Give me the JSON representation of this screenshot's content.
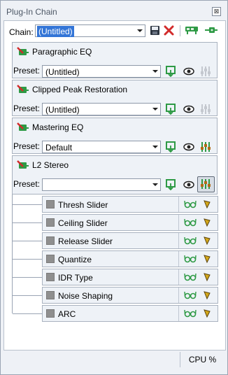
{
  "window": {
    "title": "Plug-In Chain",
    "close_glyph": "⊠"
  },
  "chain": {
    "label": "Chain:",
    "value": "(Untitled)"
  },
  "toolbar_icons": [
    "save-icon",
    "delete-icon",
    "insert-plugin-icon",
    "add-plugin-icon"
  ],
  "plugins": [
    {
      "name": "Paragraphic EQ",
      "preset_label": "Preset:",
      "preset": "(Untitled)",
      "params_icon": "sliders-disabled-icon"
    },
    {
      "name": "Clipped Peak Restoration",
      "preset_label": "Preset:",
      "preset": "(Untitled)",
      "params_icon": "sliders-disabled-icon"
    },
    {
      "name": "Mastering EQ",
      "preset_label": "Preset:",
      "preset": "Default",
      "params_icon": "sliders-icon"
    },
    {
      "name": "L2 Stereo",
      "preset_label": "Preset:",
      "preset": "",
      "params_icon": "sliders-active-icon"
    }
  ],
  "parameters": [
    {
      "label": "Thresh Slider"
    },
    {
      "label": "Ceiling Slider"
    },
    {
      "label": "Release Slider"
    },
    {
      "label": "Quantize"
    },
    {
      "label": "IDR Type"
    },
    {
      "label": "Noise Shaping"
    },
    {
      "label": "ARC"
    }
  ],
  "status": {
    "cpu_label": "CPU %"
  },
  "colors": {
    "accent_green": "#2e9a45",
    "selection": "#3375d7",
    "delete_red": "#d22b2b",
    "param_gold": "#b48a14"
  }
}
